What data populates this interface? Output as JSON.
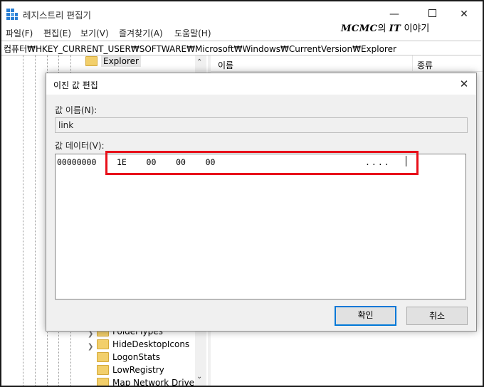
{
  "window": {
    "title": "레지스트리 편집기",
    "controls": {
      "minimize": "—",
      "close": "✕"
    }
  },
  "watermark": {
    "brand": "MCMC",
    "particle": "의",
    "it": "IT",
    "suffix": "이야기"
  },
  "menu": [
    "파일(F)",
    "편집(E)",
    "보기(V)",
    "즐겨찾기(A)",
    "도움말(H)"
  ],
  "address": "컴퓨터₩HKEY_CURRENT_USER₩SOFTWARE₩Microsoft₩Windows₩CurrentVersion₩Explorer",
  "tree": {
    "selected": "Explorer",
    "items": [
      "FolderTypes",
      "HideDesktopIcons",
      "LogonStats",
      "LowRegistry",
      "Map Network Drive M"
    ]
  },
  "list": {
    "columns": [
      "이름",
      "종류"
    ]
  },
  "dialog": {
    "title": "이진 값 편집",
    "name_label": "값 이름(N):",
    "name_value": "link",
    "data_label": "값 데이터(V):",
    "hex": {
      "address": "00000000",
      "bytes": "1E    00    00    00",
      "ascii": "...."
    },
    "ok_label": "확인",
    "cancel_label": "취소"
  },
  "colors": {
    "highlight": "#e8101a",
    "default_button_border": "#0078d7"
  }
}
